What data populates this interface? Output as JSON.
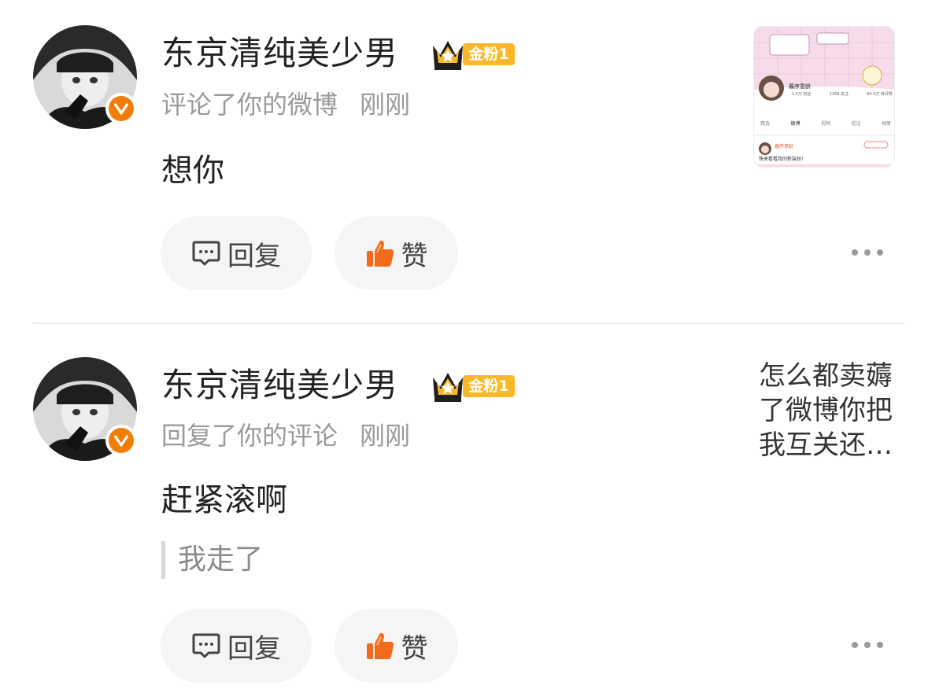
{
  "items": [
    {
      "username": "东京清纯美少男",
      "fan_badge": "金粉1",
      "action": "评论了你的微博",
      "time": "刚刚",
      "content": "想你",
      "reply_label": "回复",
      "like_label": "赞",
      "thumbnail": {
        "profile_name": "暮序意龄",
        "stats": [
          "1.4万 粉丝",
          "1368 关注",
          "60.4万 转评赞"
        ],
        "tabs": [
          "精选",
          "微博",
          "视频",
          "超话",
          "相册"
        ],
        "post_name": "暮序意龄",
        "post_text": "快来看看我的新装扮!"
      }
    },
    {
      "username": "东京清纯美少男",
      "fan_badge": "金粉1",
      "action": "回复了你的评论",
      "time": "刚刚",
      "content": "赶紧滚啊",
      "quote": "我走了",
      "reply_label": "回复",
      "like_label": "赞",
      "snippet": "怎么都卖薅了微博你把我互关还…"
    }
  ],
  "colors": {
    "badge_orange": "#f07d08",
    "fan_badge_gold": "#f8b82a",
    "like_orange": "#f26b1d",
    "meta_gray": "#9a9a9a"
  },
  "icons": [
    "verified-v-icon",
    "crown-icon",
    "comment-icon",
    "thumbs-up-icon",
    "more-icon"
  ]
}
